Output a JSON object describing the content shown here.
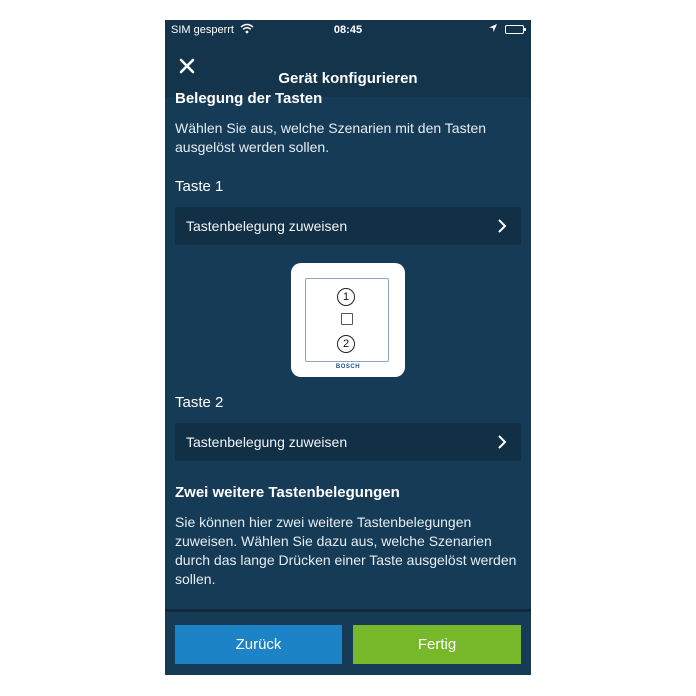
{
  "status_bar": {
    "carrier": "SIM gesperrt",
    "time": "08:45"
  },
  "nav": {
    "title": "Gerät konfigurieren",
    "close_icon": "close-icon"
  },
  "section1": {
    "heading": "Belegung der Tasten",
    "text": "Wählen Sie aus, welche Szenarien mit den Tasten ausgelöst werden sollen."
  },
  "key1": {
    "label": "Taste 1",
    "row_label": "Tastenbelegung zuweisen"
  },
  "device": {
    "button1": "1",
    "button2": "2",
    "brand": "BOSCH"
  },
  "key2": {
    "label": "Taste 2",
    "row_label": "Tastenbelegung zuweisen"
  },
  "section2": {
    "heading": "Zwei weitere Tastenbelegungen",
    "text": "Sie können hier zwei weitere Tastenbelegungen zuweisen. Wählen Sie dazu aus, welche Szenarien durch das lange Drücken einer Taste ausgelöst werden sollen."
  },
  "footer": {
    "back_label": "Zurück",
    "done_label": "Fertig"
  },
  "colors": {
    "background": "#163b56",
    "header": "#14344c",
    "row": "#112f45",
    "back_button": "#1b83c6",
    "done_button": "#76b82a"
  }
}
